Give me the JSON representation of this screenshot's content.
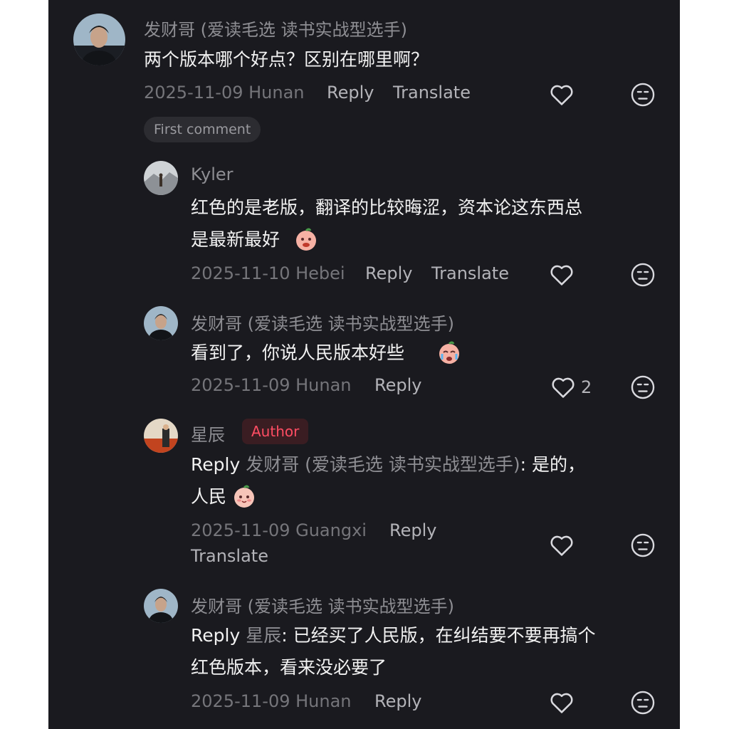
{
  "comments": [
    {
      "name": "发财哥 (爱读毛选 读书实战型选手)",
      "text": "两个版本哪个好点？区别在哪里啊？",
      "date_loc": "2025-11-09 Hunan",
      "reply": "Reply",
      "translate": "Translate",
      "avatar_icon": "person-avatar-icon"
    },
    {
      "name": "Kyler",
      "text_line1": "红色的是老版，翻译的比较晦涩，资本论这东西总",
      "text_line2": "是最新最好",
      "emoji": "drooling-face-emoji",
      "date_loc": "2025-11-10 Hebei",
      "reply": "Reply",
      "translate": "Translate"
    },
    {
      "name": "发财哥 (爱读毛选 读书实战型选手)",
      "text": "看到了，你说人民版本好些",
      "emoji": "crying-face-emoji",
      "date_loc": "2025-11-09 Hunan",
      "reply": "Reply",
      "likes": "2"
    },
    {
      "name": "星辰",
      "badge": "Author",
      "reply_word": "Reply",
      "reply_target": "发财哥 (爱读毛选 读书实战型选手)",
      "text_line1_rest": ": 是的，",
      "text_line2": "人民",
      "emoji": "smiling-face-emoji",
      "date_loc": "2025-11-09 Guangxi",
      "reply": "Reply",
      "translate": "Translate"
    },
    {
      "name": "发财哥 (爱读毛选 读书实战型选手)",
      "reply_word": "Reply",
      "reply_target": "星辰",
      "text_line1_rest": ": 已经买了人民版，在纠结要不要再搞个",
      "text_line2": "红色版本，看来没必要了",
      "date_loc": "2025-11-09 Hunan",
      "reply": "Reply"
    }
  ],
  "first_comment_label": "First comment",
  "colors": {
    "background": "#1a1a1f",
    "author_badge": "#ff4d63",
    "text": "#f2f2f2",
    "muted": "#8e8e93"
  },
  "icons": {
    "like": "heart-outline-icon",
    "dislike": "neutral-face-icon"
  }
}
